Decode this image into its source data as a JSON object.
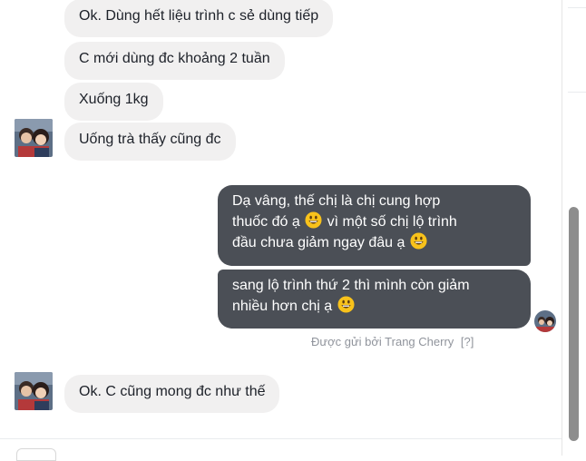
{
  "conversation": {
    "messages": [
      {
        "direction": "incoming",
        "text": "Ok. Dùng hết liệu trình c sẻ dùng tiếp"
      },
      {
        "direction": "incoming",
        "text": "C mới dùng đc khoảng 2 tuần"
      },
      {
        "direction": "incoming",
        "text": "Xuống 1kg"
      },
      {
        "direction": "incoming",
        "text": "Uống trà thấy cũng đc"
      },
      {
        "direction": "outgoing",
        "lines": [
          "Dạ vâng, thế chị là chị cung hợp",
          "thuốc đó ạ",
          "vì một số chị lộ trình",
          "đầu chưa giảm ngay đâu ạ"
        ]
      },
      {
        "direction": "outgoing",
        "lines": [
          "sang lộ trình thứ 2 thì mình còn giảm",
          "nhiều hơn chị ạ"
        ]
      },
      {
        "direction": "incoming",
        "text": "Ok. C cũng mong đc như thế"
      }
    ],
    "sent_by": "Được gửi bởi Trang Cherry",
    "sent_by_help": "[?]",
    "emoji_name": "grinning-face-emoji"
  },
  "colors": {
    "incoming_bubble": "#f1f0f0",
    "outgoing_bubble": "#4b4f56",
    "meta_text": "#90949c"
  }
}
